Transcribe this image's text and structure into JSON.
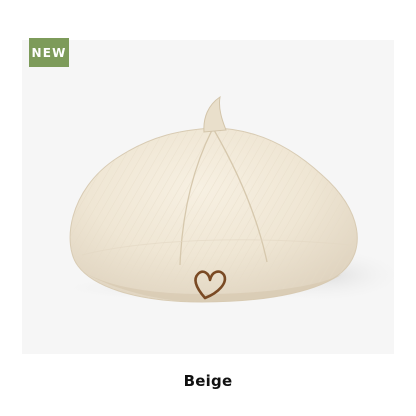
{
  "badge": {
    "label": "NEW",
    "color": "#7d9b5a"
  },
  "product": {
    "color_label": "Beige",
    "image_icon": "beret-hat-image",
    "hat_color": "#efe7d6",
    "embroidery_color": "#7a4a24"
  }
}
